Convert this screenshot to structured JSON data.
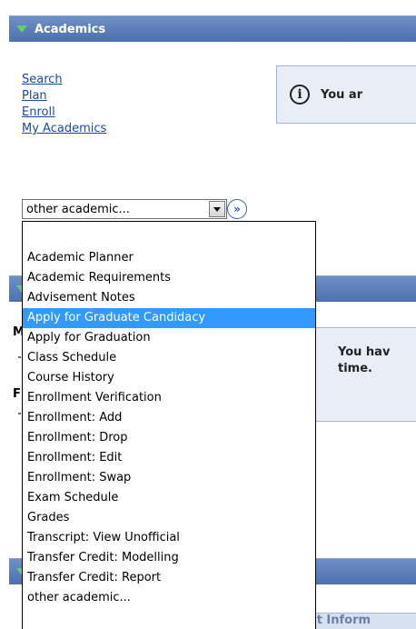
{
  "academics": {
    "header_title": "Academics",
    "links": [
      "Search",
      "Plan",
      "Enroll",
      "My Academics"
    ],
    "info_text": "You ar",
    "select": {
      "value": "other academic...",
      "options": [
        "Academic Planner",
        "Academic Requirements",
        "Advisement Notes",
        "Apply for Graduate Candidacy",
        "Apply for Graduation",
        "Class Schedule",
        "Course History",
        "Enrollment Verification",
        "Enrollment: Add",
        "Enrollment: Drop",
        "Enrollment: Edit",
        "Enrollment: Swap",
        "Exam Schedule",
        "Grades",
        "Transcript: View Unofficial",
        "Transfer Credit: Modelling",
        "Transfer Credit: Report",
        "other academic..."
      ],
      "highlighted": "Apply for Graduate Candidacy"
    }
  },
  "background": {
    "message_line1": "You hav",
    "message_line2": "time.",
    "letter_m": "M",
    "letter_f": "F",
    "contact_tab": "tact Inform"
  },
  "colors": {
    "header_bg": "#5b7fb8",
    "link": "#1a4aa8",
    "highlight": "#3399ff"
  }
}
